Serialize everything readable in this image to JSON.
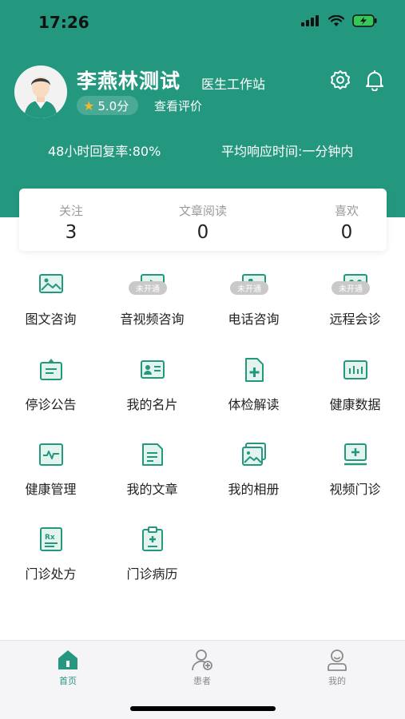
{
  "status_bar": {
    "time": "17:26"
  },
  "profile": {
    "name": "李燕林测试",
    "tag": "医生工作站",
    "rating": "5.0分",
    "review_link": "查看评价",
    "reply_rate": "48小时回复率:80%",
    "response_time": "平均响应时间:一分钟内"
  },
  "stats": [
    {
      "label": "关注",
      "value": "3"
    },
    {
      "label": "文章阅读",
      "value": "0"
    },
    {
      "label": "喜欢",
      "value": "0"
    }
  ],
  "grid": [
    {
      "label": "图文咨询",
      "icon": "image-consult-icon",
      "badge": ""
    },
    {
      "label": "音视频咨询",
      "icon": "video-consult-icon",
      "badge": "未开通"
    },
    {
      "label": "电话咨询",
      "icon": "phone-consult-icon",
      "badge": "未开通"
    },
    {
      "label": "远程会诊",
      "icon": "remote-consult-icon",
      "badge": "未开通"
    },
    {
      "label": "停诊公告",
      "icon": "notice-icon",
      "badge": ""
    },
    {
      "label": "我的名片",
      "icon": "business-card-icon",
      "badge": ""
    },
    {
      "label": "体检解读",
      "icon": "checkup-report-icon",
      "badge": ""
    },
    {
      "label": "健康数据",
      "icon": "health-data-icon",
      "badge": ""
    },
    {
      "label": "健康管理",
      "icon": "health-management-icon",
      "badge": ""
    },
    {
      "label": "我的文章",
      "icon": "article-icon",
      "badge": ""
    },
    {
      "label": "我的相册",
      "icon": "album-icon",
      "badge": ""
    },
    {
      "label": "视频门诊",
      "icon": "video-clinic-icon",
      "badge": ""
    },
    {
      "label": "门诊处方",
      "icon": "prescription-icon",
      "badge": ""
    },
    {
      "label": "门诊病历",
      "icon": "medical-record-icon",
      "badge": ""
    }
  ],
  "tabs": [
    {
      "label": "首页",
      "icon": "home-icon",
      "active": true
    },
    {
      "label": "患者",
      "icon": "patients-icon",
      "active": false
    },
    {
      "label": "我的",
      "icon": "profile-icon",
      "active": false
    }
  ],
  "colors": {
    "primary": "#24987f",
    "badge": "#c9c9c9"
  }
}
